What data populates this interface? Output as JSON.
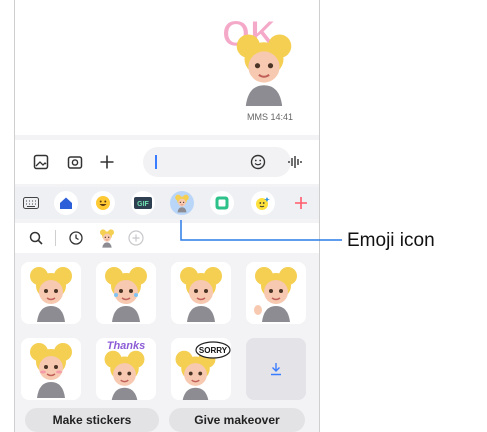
{
  "chat": {
    "timestamp": "MMS 14:41"
  },
  "compose": {
    "gallery_icon": "gallery-icon",
    "camera_icon": "camera-icon",
    "attach_icon": "plus-icon",
    "emoji_icon": "smiley-icon",
    "voice_icon": "voice-icon"
  },
  "tabs": [
    {
      "name": "keyboard",
      "icon": "keyboard-icon"
    },
    {
      "name": "home",
      "icon": "home-icon"
    },
    {
      "name": "emoji",
      "icon": "emoji-face-icon"
    },
    {
      "name": "gif",
      "icon": "gif-icon",
      "label": "GIF"
    },
    {
      "name": "ar-emoji",
      "icon": "ar-emoji-icon",
      "selected": true
    },
    {
      "name": "sticker",
      "icon": "sticker-icon"
    },
    {
      "name": "bitmoji",
      "icon": "bitmoji-icon"
    },
    {
      "name": "add",
      "icon": "plus-icon"
    }
  ],
  "tools": {
    "search_icon": "search-icon",
    "recent_icon": "clock-icon",
    "add_icon": "plus-circle-icon"
  },
  "stickers": {
    "download_icon": "download-icon",
    "texts": {
      "thanks": "Thanks",
      "sorry": "SORRY"
    }
  },
  "buttons": {
    "make_stickers": "Make stickers",
    "give_makeover": "Give makeover"
  },
  "callout": {
    "label": "Emoji icon"
  },
  "colors": {
    "accent": "#3a7cff",
    "callout_line": "#2b7be8",
    "hair": "#f4cf52",
    "hoodie": "#8c8c92"
  }
}
